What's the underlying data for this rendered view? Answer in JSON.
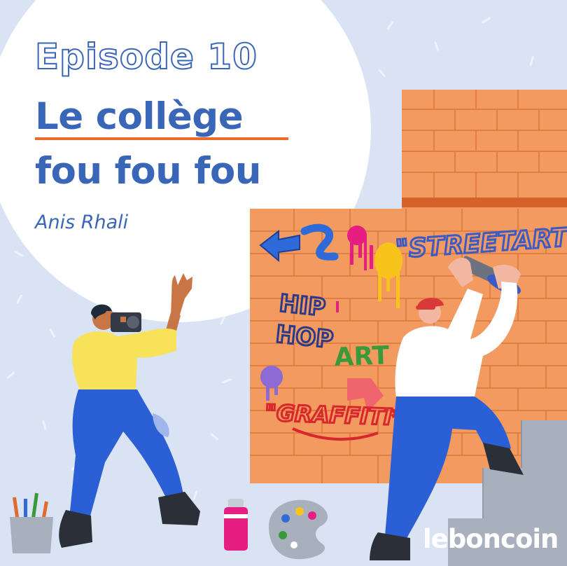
{
  "cover": {
    "episode": "Episode 10",
    "title_line1": "Le collège",
    "title_line2": "fou fou fou",
    "author": "Anis Rhali",
    "brand": "leboncoin"
  },
  "graffiti": {
    "tag_streetart": "\"STREETART*",
    "tag_hip": "HIP",
    "tag_hop": "HOP",
    "tag_art": "ART",
    "tag_graffiti": "\"GRAFFITI*"
  },
  "colors": {
    "background": "#d9e3f4",
    "circle": "#ffffff",
    "title_blue": "#3a66b8",
    "underline_orange": "#ec6b2b",
    "brick": "#f29a5f",
    "stairs": "#a9b0bd"
  },
  "icons": [
    "camera-icon",
    "spray-can-icon",
    "paint-palette-icon",
    "paintbrush-cup-icon"
  ]
}
